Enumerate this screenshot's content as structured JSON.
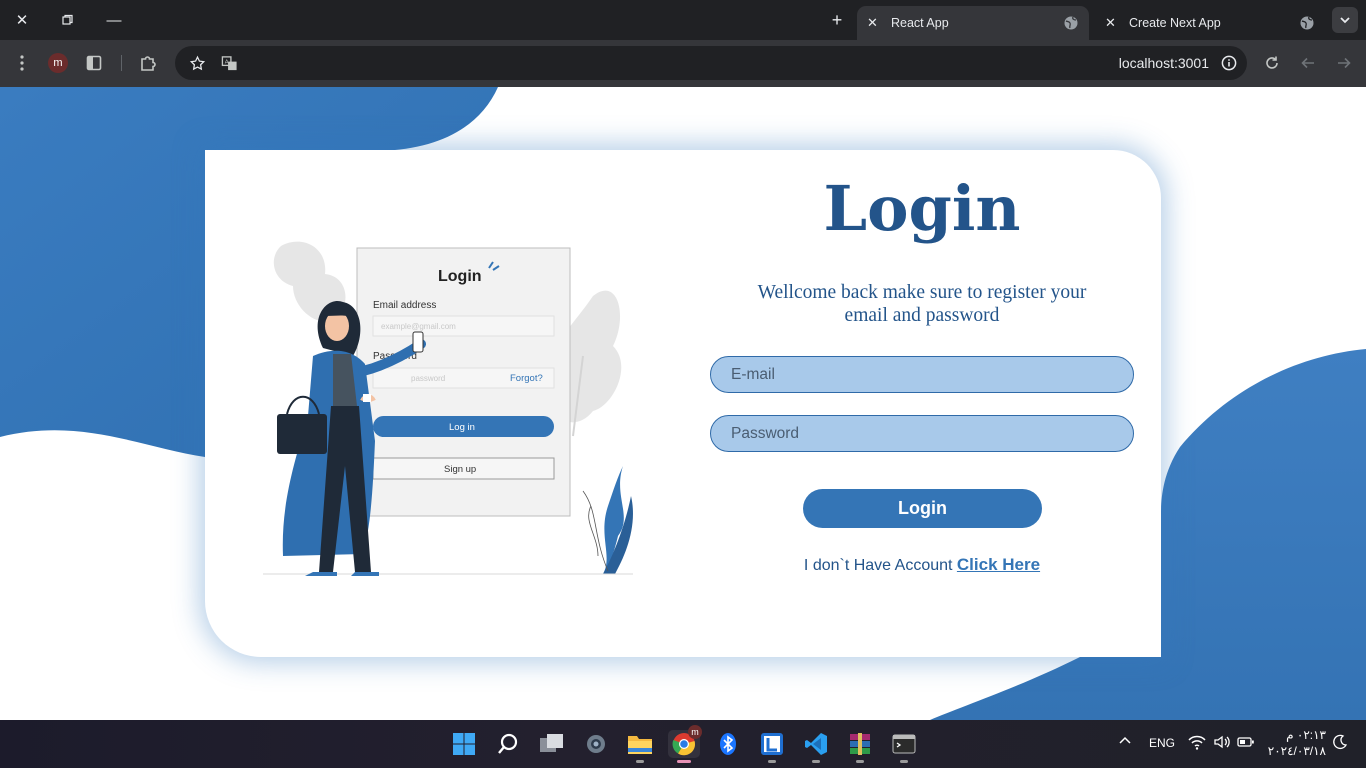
{
  "browser": {
    "tabs": [
      {
        "label": "React App",
        "active": true
      },
      {
        "label": "Create Next App",
        "active": false
      }
    ],
    "url": "localhost:3001",
    "profile_initial": "m"
  },
  "page": {
    "illustration": {
      "form_title": "Login",
      "email_label": "Email address",
      "email_placeholder": "example@gmail.com",
      "password_label": "Password",
      "password_placeholder": "password",
      "forgot": "Forgot?",
      "login_button": "Log in",
      "signup_button": "Sign up"
    },
    "title": "Login",
    "subtitle": "Wellcome back make sure to register your email and password",
    "email_placeholder": "E-mail",
    "password_placeholder": "Password",
    "login_button": "Login",
    "account_prompt": "I don`t Have Account",
    "account_link": "Click Here"
  },
  "taskbar": {
    "language": "ENG",
    "time": "٠٢:١٣ م",
    "date": "٢٠٢٤/٠٣/١٨"
  },
  "colors": {
    "brand_blue": "#3475b6",
    "heading_blue": "#23548a",
    "input_fill": "#a8c9ea"
  }
}
